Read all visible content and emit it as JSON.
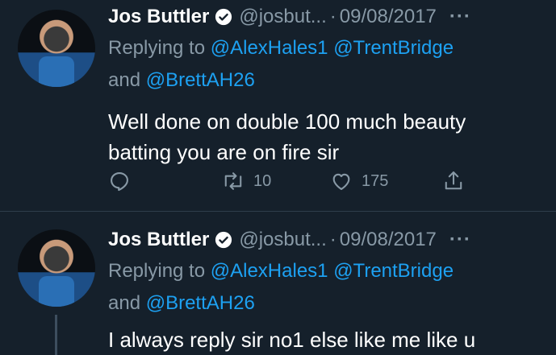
{
  "tweets": [
    {
      "author_name": "Jos Buttler",
      "handle": "@josbut...",
      "separator": "·",
      "date": "09/08/2017",
      "more": "···",
      "replying_prefix": "Replying to",
      "mentions": [
        "@AlexHales1",
        "@TrentBridge",
        "@BrettAH26"
      ],
      "and_word": "and",
      "text": "Well done on double 100 much beauty batting you are on fire sir",
      "retweets": "10",
      "likes": "175"
    },
    {
      "author_name": "Jos Buttler",
      "handle": "@josbut...",
      "separator": "·",
      "date": "09/08/2017",
      "more": "···",
      "replying_prefix": "Replying to",
      "mentions": [
        "@AlexHales1",
        "@TrentBridge",
        "@BrettAH26"
      ],
      "and_word": "and",
      "text": "I always reply sir no1 else like me like u"
    }
  ],
  "icons": {
    "verified": "verified-badge-icon",
    "reply": "reply-icon",
    "retweet": "retweet-icon",
    "like": "heart-icon",
    "share": "share-icon"
  },
  "colors": {
    "background": "#15202b",
    "link": "#1da1f2",
    "muted": "#8899a6"
  }
}
